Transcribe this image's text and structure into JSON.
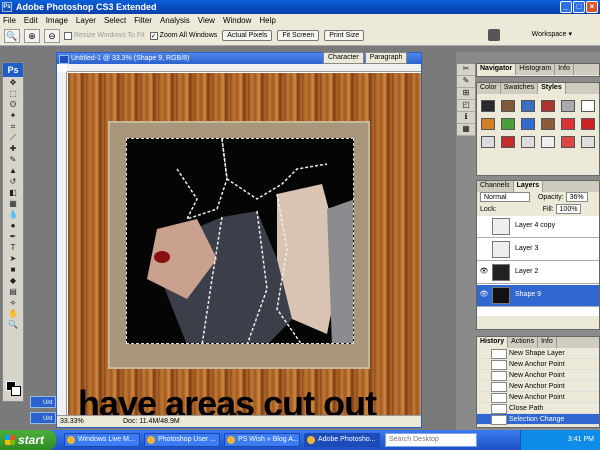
{
  "window": {
    "title": "Adobe Photoshop CS3 Extended",
    "minimize": "_",
    "maximize": "□",
    "close": "×"
  },
  "menu": [
    "File",
    "Edit",
    "Image",
    "Layer",
    "Select",
    "Filter",
    "Analysis",
    "View",
    "Window",
    "Help"
  ],
  "options": {
    "resize_windows": "Resize Windows To Fit",
    "zoom_all": "Zoom All Windows",
    "actual_pixels": "Actual Pixels",
    "fit_screen": "Fit Screen",
    "print_size": "Print Size",
    "workspace": "Workspace ▾"
  },
  "document": {
    "title": "Untitled-1 @ 33.3% (Shape 9, RGB/8)",
    "overlay_text": "have areas cut out",
    "zoom": "33.33%",
    "doc_size": "Doc: 11.4M/48.9M"
  },
  "minimized_docs": [
    "Unt",
    "Unt"
  ],
  "character_tabs": [
    "Character",
    "Paragraph"
  ],
  "navigator_tabs": [
    "Navigator",
    "Histogram",
    "Info"
  ],
  "styles_tabs": [
    "Color",
    "Swatches",
    "Styles"
  ],
  "style_colors": [
    "#2a2a2a",
    "#7c5b3a",
    "#3b6fbf",
    "#a33",
    "#aaa",
    "#fff",
    "#d27f2a",
    "#4a9e3c",
    "#2f6ecf",
    "#8b5c3c",
    "#d33",
    "#c22",
    "#dcdcdc",
    "#c12f2f",
    "#ddd",
    "#eee",
    "#d44",
    "#ddd"
  ],
  "layers_panel": {
    "tabs": [
      "Channels",
      "Layers"
    ],
    "blend_mode": "Normal",
    "opacity_label": "Opacity:",
    "opacity": "36%",
    "lock_label": "Lock:",
    "fill_label": "Fill:",
    "fill": "100%",
    "layers": [
      {
        "name": "Layer 4 copy",
        "visible": false,
        "active": false
      },
      {
        "name": "Layer 3",
        "visible": false,
        "active": false
      },
      {
        "name": "Layer 2",
        "visible": true,
        "active": false
      },
      {
        "name": "Shape 9",
        "visible": true,
        "active": true
      }
    ]
  },
  "history_panel": {
    "tabs": [
      "History",
      "Actions",
      "Info"
    ],
    "items": [
      {
        "label": "New Shape Layer",
        "active": false
      },
      {
        "label": "New Anchor Point",
        "active": false
      },
      {
        "label": "New Anchor Point",
        "active": false
      },
      {
        "label": "New Anchor Point",
        "active": false
      },
      {
        "label": "New Anchor Point",
        "active": false
      },
      {
        "label": "Close Path",
        "active": false
      },
      {
        "label": "Selection Change",
        "active": true
      }
    ]
  },
  "taskbar": {
    "start": "start",
    "buttons": [
      "Windows Live M...",
      "Photoshop User ...",
      "PS Wish » Blog A...",
      "Adobe Photosho..."
    ],
    "search_placeholder": "Search Desktop",
    "clock": "3:41 PM"
  }
}
